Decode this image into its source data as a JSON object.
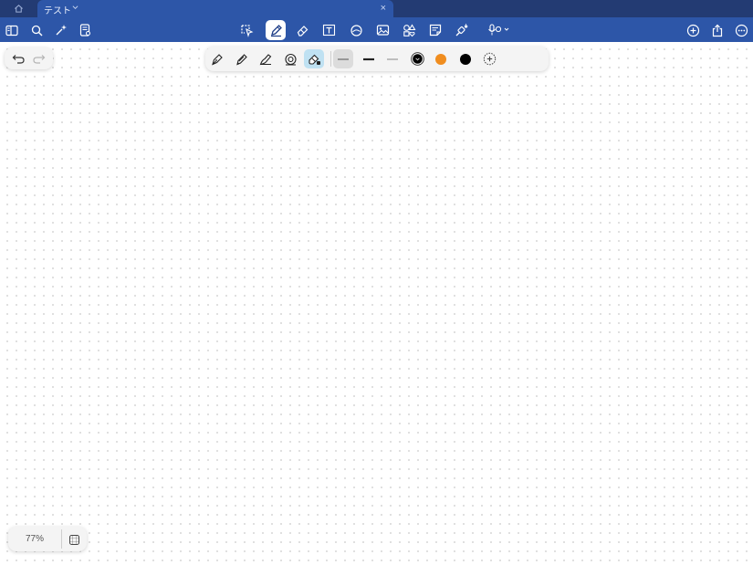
{
  "tabbar": {
    "home_icon": "home-icon",
    "tab": {
      "title": "テスト",
      "chevron_icon": "chevron-down-icon",
      "close_label": "×"
    }
  },
  "toolbar": {
    "left": [
      "sidebar-icon",
      "search-icon",
      "ai-sparkle-icon",
      "page-outline-icon"
    ],
    "center": [
      "lasso-select-icon",
      "pen-icon",
      "eraser-icon",
      "text-box-icon",
      "shapes-icon",
      "image-icon",
      "elements-icon",
      "sticky-note-icon",
      "laser-pointer-icon",
      "audio-record-icon"
    ],
    "active_tool": "pen-icon",
    "right": [
      "add-icon",
      "share-icon",
      "more-icon"
    ]
  },
  "undo_redo": {
    "undo_icon": "undo-icon",
    "redo_icon": "redo-icon",
    "redo_enabled": false
  },
  "pen_palette": {
    "tools": [
      "fountain-pen-icon",
      "ball-pen-icon",
      "brush-pen-icon",
      "pencil-icon",
      "highlighter-icon"
    ],
    "selected_tool": "highlighter-icon",
    "widths": [
      "fine",
      "medium",
      "thick"
    ],
    "selected_width": "fine",
    "colors": [
      "#000000",
      "#f08d1f",
      "#000000"
    ],
    "selected_color": 0,
    "add_color_icon": "add-color-icon"
  },
  "zoom": {
    "level": "77%",
    "fit_icon": "fit-to-screen-icon"
  },
  "colors": {
    "tabbar_bg": "#233b73",
    "toolbar_bg": "#2d56a8",
    "accent_highlight": "#bfe1f2"
  }
}
